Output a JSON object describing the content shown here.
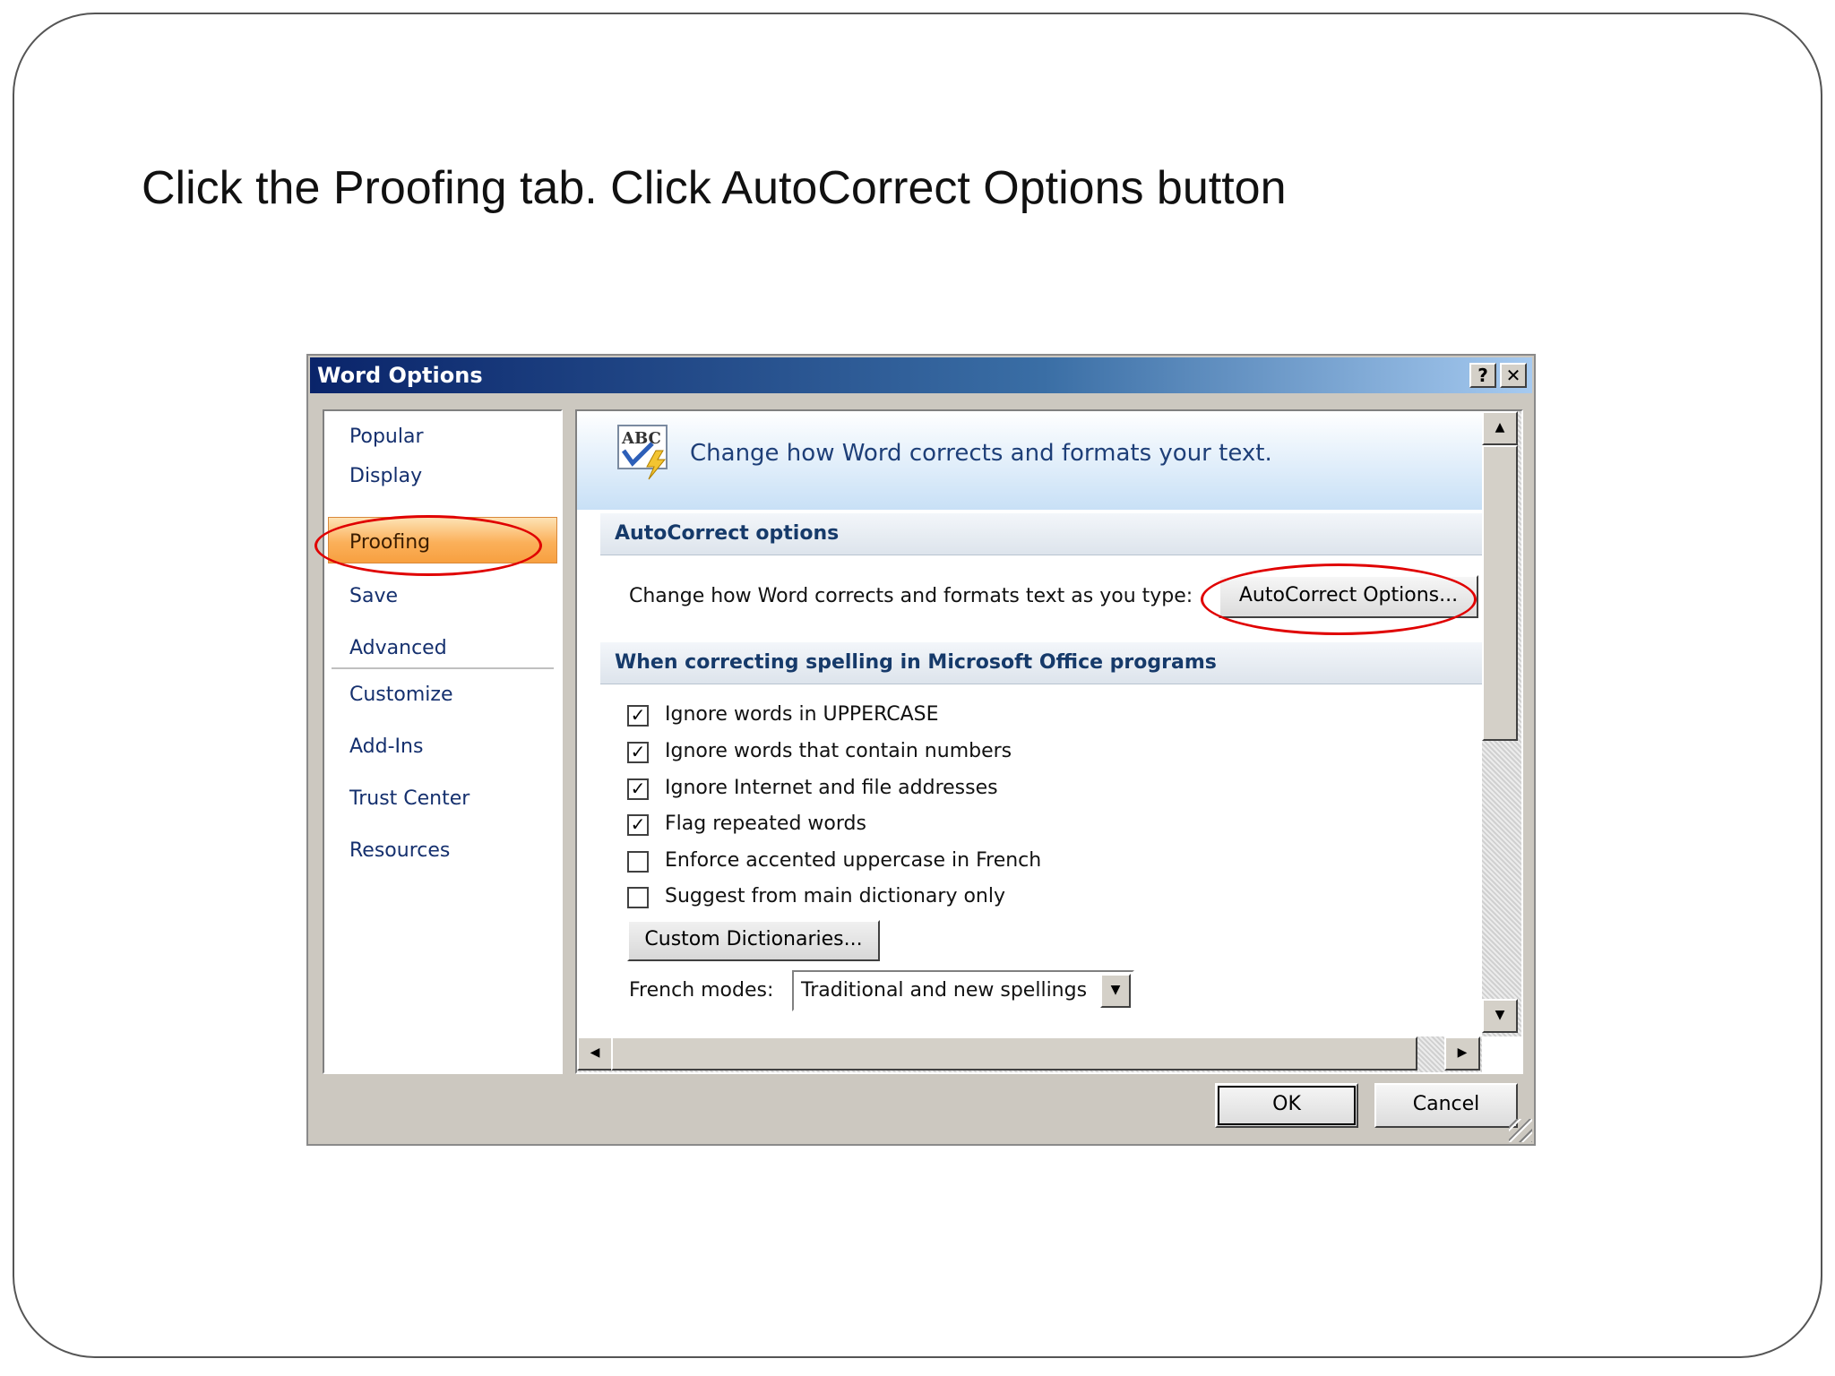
{
  "slide": {
    "instruction": "Click the Proofing tab. Click AutoCorrect Options button"
  },
  "dialog": {
    "title": "Word Options",
    "help_button": "?",
    "close_button": "✕",
    "nav": {
      "items": [
        "Popular",
        "Display",
        "Proofing",
        "Save",
        "Advanced",
        "Customize",
        "Add-Ins",
        "Trust Center",
        "Resources"
      ],
      "selected": "Proofing"
    },
    "header": {
      "text": "Change how Word corrects and formats your text.",
      "icon_text": "ABC"
    },
    "autocorrect_section": {
      "title": "AutoCorrect options",
      "description": "Change how Word corrects and formats text as you type:",
      "button_label": "AutoCorrect Options..."
    },
    "spelling_section": {
      "title": "When correcting spelling in Microsoft Office programs",
      "options": [
        {
          "label": "Ignore words in UPPERCASE",
          "checked": true
        },
        {
          "label": "Ignore words that contain numbers",
          "checked": true
        },
        {
          "label": "Ignore Internet and file addresses",
          "checked": true
        },
        {
          "label": "Flag repeated words",
          "checked": true
        },
        {
          "label": "Enforce accented uppercase in French",
          "checked": false
        },
        {
          "label": "Suggest from main dictionary only",
          "checked": false
        }
      ],
      "custom_dictionaries_label": "Custom Dictionaries...",
      "french_modes_label": "French modes:",
      "french_modes_value": "Traditional and new spellings"
    },
    "buttons": {
      "ok": "OK",
      "cancel": "Cancel"
    },
    "colors": {
      "highlight_ellipse": "#e00000",
      "title_bar": "#0a246a",
      "nav_selected": "#fbb05a",
      "section_text": "#163a6a"
    }
  }
}
